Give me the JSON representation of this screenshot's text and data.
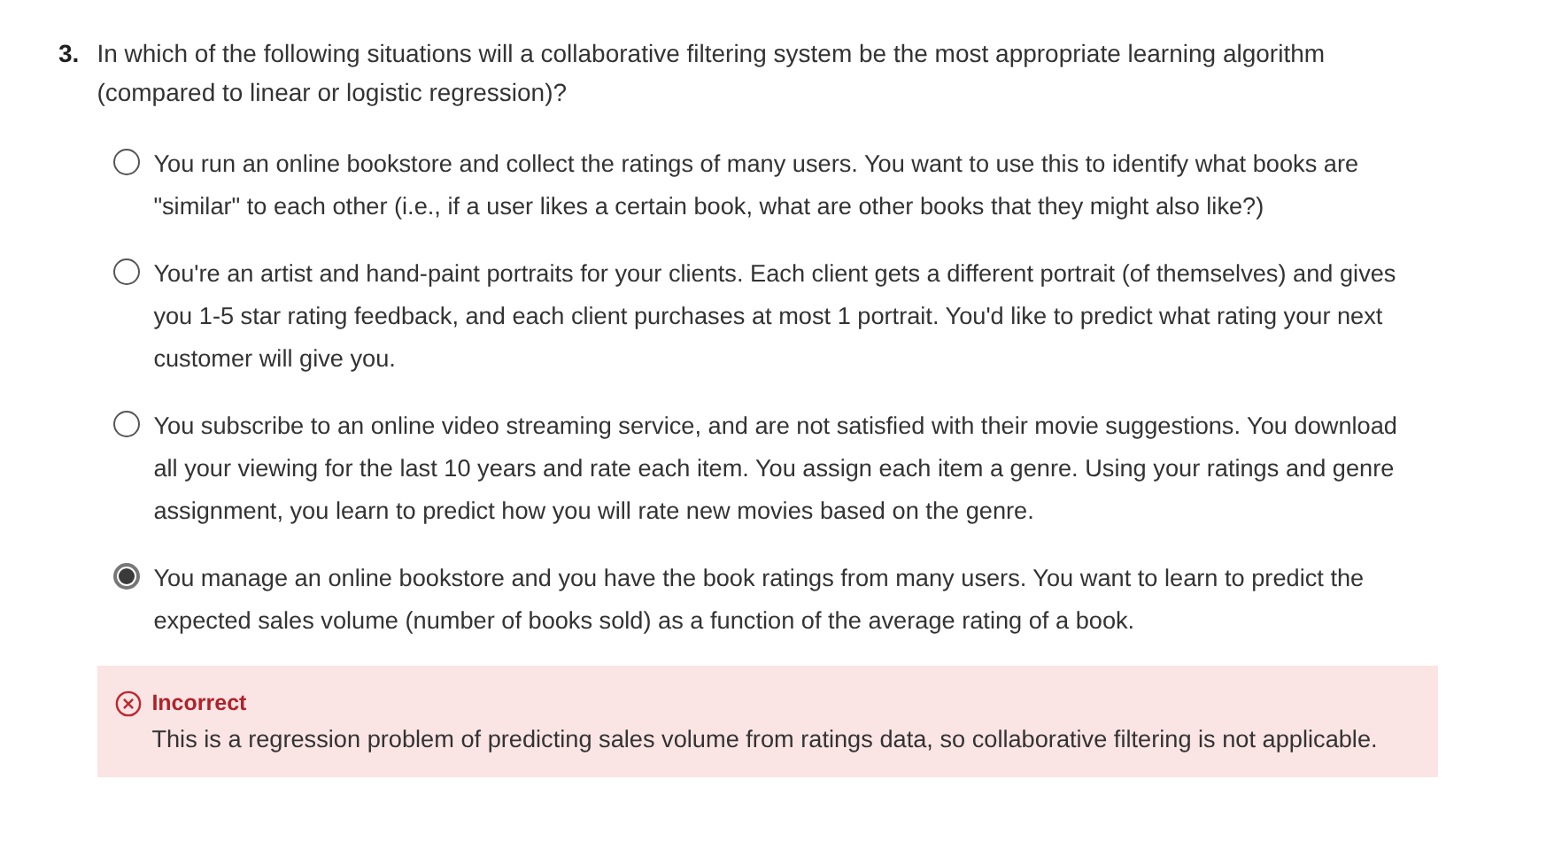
{
  "question": {
    "number": "3.",
    "text": "In which of the following situations will a collaborative filtering system be the most appropriate learning algorithm (compared to linear or logistic regression)?"
  },
  "options": [
    {
      "text": "You run an online bookstore and collect the ratings of many users. You want to use this to identify what books are \"similar\" to each other (i.e., if a user likes a certain book, what are other books that they might also like?)",
      "selected": false
    },
    {
      "text": "You're an artist and hand-paint portraits for your clients. Each client gets a different portrait (of themselves) and gives you 1-5 star rating feedback, and each client purchases at most 1 portrait. You'd like to predict what rating your next customer will give you.",
      "selected": false
    },
    {
      "text": "You subscribe to an online video streaming service, and are not satisfied with their movie suggestions. You download all your viewing for the last 10 years and rate each item. You assign each item a genre. Using your ratings and genre assignment, you learn to predict how you will rate new movies based on the genre.",
      "selected": false
    },
    {
      "text": "You manage an online bookstore and you have the book ratings from many users. You want to learn to predict the expected sales volume (number of books sold) as a function of the average rating of a book.",
      "selected": true
    }
  ],
  "feedback": {
    "kind": "incorrect",
    "title": "Incorrect",
    "text": "This is a regression problem of predicting sales volume from ratings data, so collaborative filtering is not applicable."
  }
}
